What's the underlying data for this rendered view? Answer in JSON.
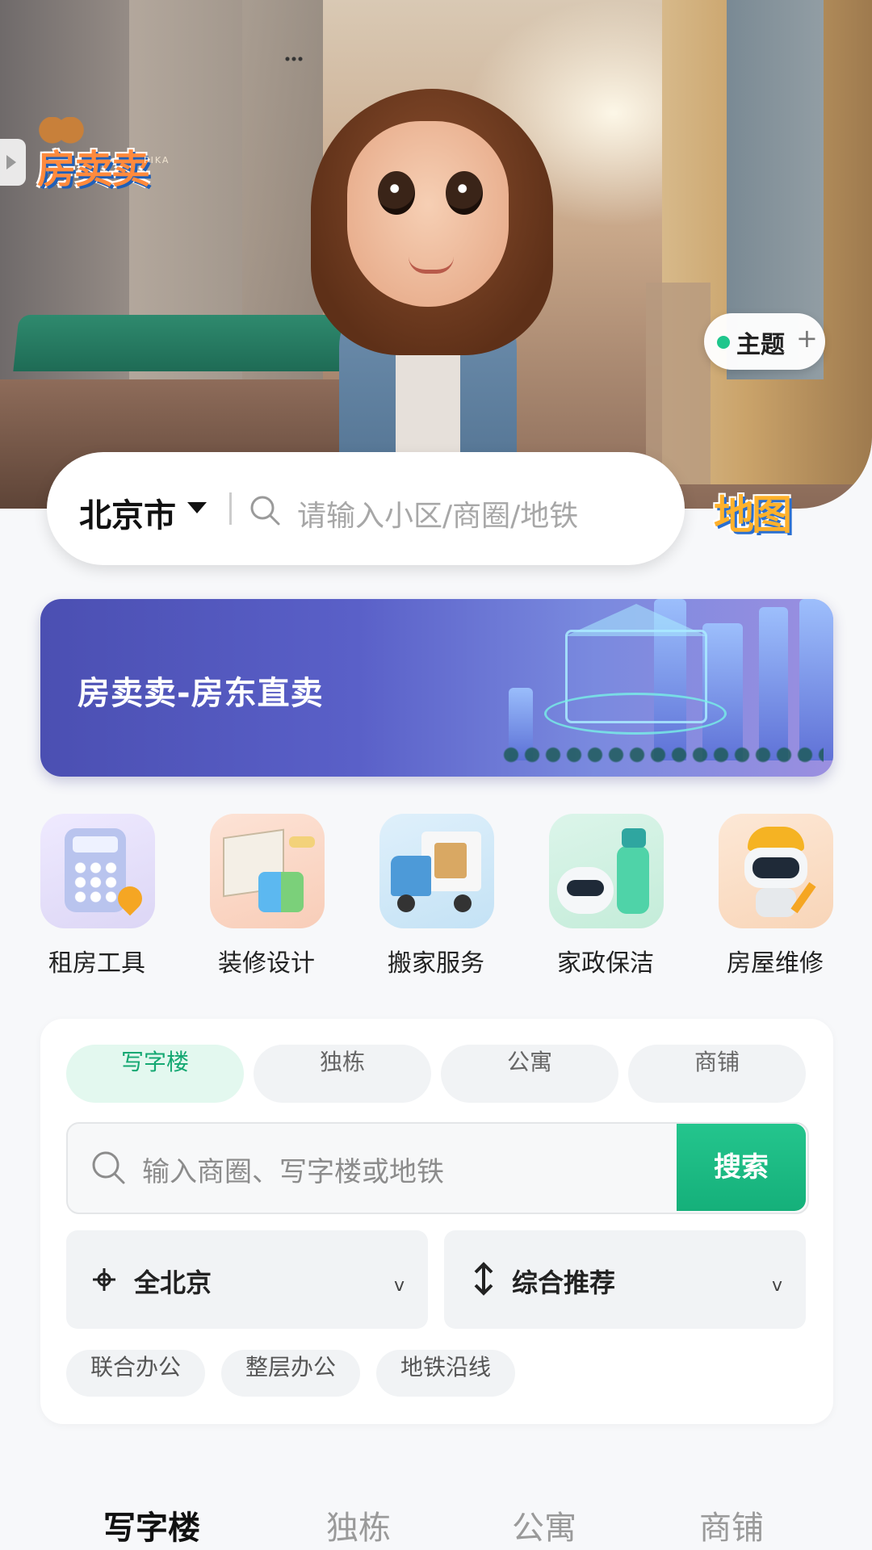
{
  "hero": {
    "brand_logo": "房卖卖",
    "brand_sub": "PIKA",
    "theme_label": "主题",
    "theme_plus": "+"
  },
  "search": {
    "city": "北京市",
    "placeholder": "请输入小区/商圈/地铁",
    "map_label": "地图"
  },
  "banner": {
    "title": "房卖卖-房东直卖"
  },
  "services": [
    {
      "label": "租房工具",
      "icon": "calculator-icon"
    },
    {
      "label": "装修设计",
      "icon": "blueprint-paint-icon"
    },
    {
      "label": "搬家服务",
      "icon": "moving-truck-icon"
    },
    {
      "label": "家政保洁",
      "icon": "cleaning-robot-icon"
    },
    {
      "label": "房屋维修",
      "icon": "repair-robot-icon"
    }
  ],
  "filter": {
    "tabs": [
      "写字楼",
      "独栋",
      "公寓",
      "商铺"
    ],
    "active_tab": "写字楼",
    "search_placeholder": "输入商圈、写字楼或地铁",
    "search_button": "搜索",
    "location_dropdown": "全北京",
    "sort_dropdown": "综合推荐",
    "chips": [
      "联合办公",
      "整层办公",
      "地铁沿线"
    ]
  },
  "bottom_tabs": [
    "写字楼",
    "独栋",
    "公寓",
    "商铺"
  ],
  "colors": {
    "accent": "#1fc68c",
    "active_tab_bg": "#e3f8ef",
    "banner": "#4b4fb2"
  }
}
